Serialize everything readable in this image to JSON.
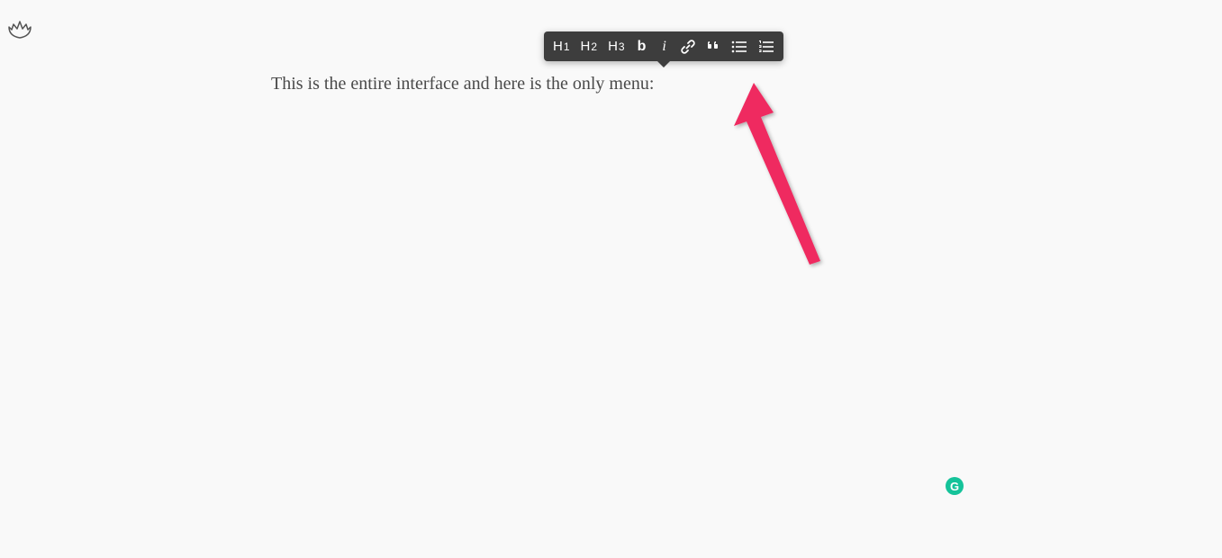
{
  "logo": {
    "name": "lotus-icon"
  },
  "editor": {
    "content": "This is the entire interface and here is the only menu:"
  },
  "toolbar": {
    "items": [
      {
        "label_prefix": "H",
        "label_num": "1",
        "name": "heading-1"
      },
      {
        "label_prefix": "H",
        "label_num": "2",
        "name": "heading-2"
      },
      {
        "label_prefix": "H",
        "label_num": "3",
        "name": "heading-3"
      },
      {
        "label": "b",
        "name": "bold"
      },
      {
        "label": "i",
        "name": "italic"
      },
      {
        "name": "link"
      },
      {
        "name": "quote"
      },
      {
        "name": "unordered-list"
      },
      {
        "name": "ordered-list"
      }
    ]
  },
  "badge": {
    "label": "G"
  }
}
